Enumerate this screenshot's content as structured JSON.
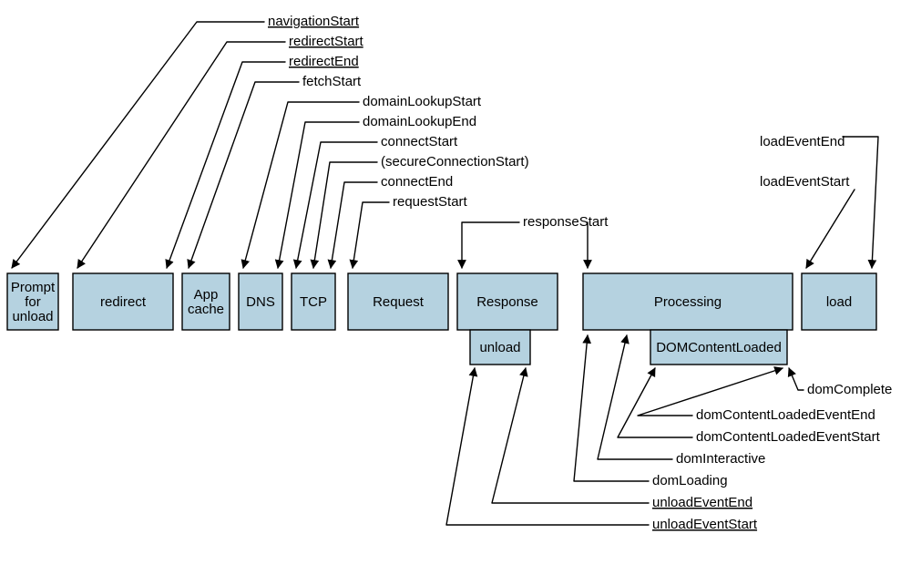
{
  "boxes": {
    "prompt": {
      "line1": "Prompt",
      "line2": "for",
      "line3": "unload"
    },
    "redirect": "redirect",
    "appcache": {
      "line1": "App",
      "line2": "cache"
    },
    "dns": "DNS",
    "tcp": "TCP",
    "request": "Request",
    "response": "Response",
    "processing": "Processing",
    "load": "load",
    "unload": "unload",
    "dcl": "DOMContentLoaded"
  },
  "labels": {
    "navigationStart": "navigationStart",
    "redirectStart": "redirectStart",
    "redirectEnd": "redirectEnd",
    "fetchStart": "fetchStart",
    "domainLookupStart": "domainLookupStart",
    "domainLookupEnd": "domainLookupEnd",
    "connectStart": "connectStart",
    "secureConnectionStart": "(secureConnectionStart)",
    "connectEnd": "connectEnd",
    "requestStart": "requestStart",
    "responseStart": "responseStart",
    "loadEventEnd": "loadEventEnd",
    "loadEventStart": "loadEventStart",
    "domComplete": "domComplete",
    "domContentLoadedEventEnd": "domContentLoadedEventEnd",
    "domContentLoadedEventStart": "domContentLoadedEventStart",
    "domInteractive": "domInteractive",
    "domLoading": "domLoading",
    "unloadEventEnd": "unloadEventEnd",
    "unloadEventStart": "unloadEventStart"
  },
  "underline": [
    "navigationStart",
    "redirectStart",
    "redirectEnd",
    "unloadEventEnd",
    "unloadEventStart"
  ]
}
